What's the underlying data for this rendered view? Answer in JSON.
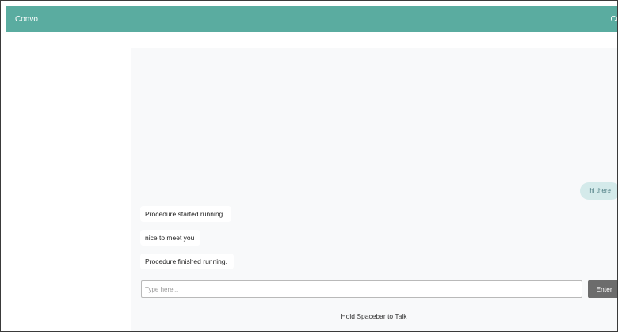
{
  "navbar": {
    "brand": "Convo",
    "right_text": "Cr"
  },
  "chat": {
    "messages": [
      {
        "sender": "user",
        "text": "hi there"
      },
      {
        "sender": "bot",
        "text": "Procedure started running."
      },
      {
        "sender": "bot",
        "text": "nice to meet you"
      },
      {
        "sender": "bot",
        "text": "Procedure finished running."
      }
    ],
    "input": {
      "value": "",
      "placeholder": "Type here..."
    },
    "enter_label": "Enter",
    "talk_hint": "Hold Spacebar to Talk"
  },
  "colors": {
    "navbar_bg": "#5aaca0",
    "user_bubble": "#d4eaea",
    "chat_bg": "#f8f9fa",
    "enter_button": "#6c6c6c"
  }
}
